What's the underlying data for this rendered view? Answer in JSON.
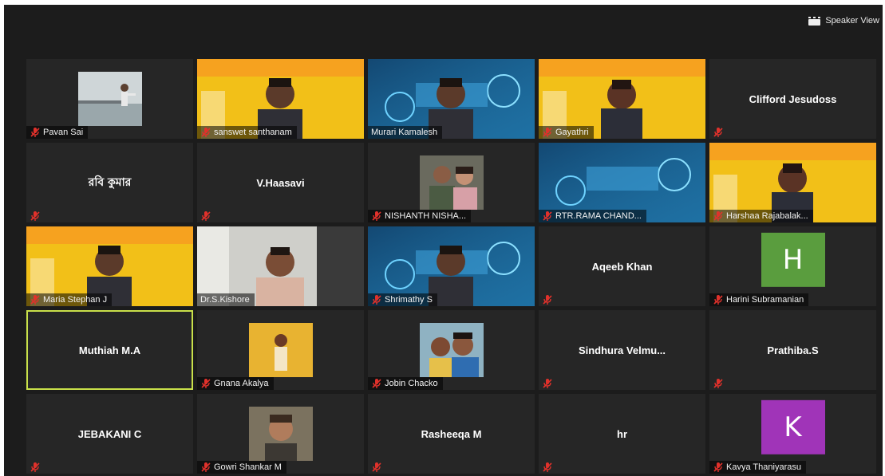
{
  "header": {
    "speaker_view_label": "Speaker View"
  },
  "icons": {
    "muted": "mic-muted-icon",
    "speaker_view": "speaker-view-icon"
  },
  "colors": {
    "background": "#1c1c1c",
    "tile": "#262626",
    "active_border": "#c9e04a",
    "muted_icon": "#e0312b"
  },
  "participants": [
    {
      "name": "Pavan Sai",
      "type": "photo",
      "muted": true,
      "photo": "pier"
    },
    {
      "name": "sanswet santhanam",
      "type": "video",
      "muted": true,
      "video": "yellowbanner"
    },
    {
      "name": "Murari Kamalesh",
      "type": "video",
      "muted": false,
      "video": "techbanner"
    },
    {
      "name": "Gayathri",
      "type": "video",
      "muted": true,
      "video": "yellowgirl"
    },
    {
      "name": "Clifford Jesudoss",
      "type": "text",
      "muted": true,
      "show_label": false
    },
    {
      "name": "রবি কুমার",
      "type": "text",
      "muted": true,
      "show_label": false,
      "script": "bn"
    },
    {
      "name": "V.Haasavi",
      "type": "text",
      "muted": true,
      "show_label": false
    },
    {
      "name": "NISHANTH NISHA...",
      "type": "photo",
      "muted": true,
      "photo": "couple"
    },
    {
      "name": "RTR.RAMA CHAND...",
      "type": "video",
      "muted": true,
      "video": "bluebanner"
    },
    {
      "name": "Harshaa Rajabalak...",
      "type": "video",
      "muted": true,
      "video": "yellowgirl2"
    },
    {
      "name": "Maria Stephan J",
      "type": "video",
      "muted": true,
      "video": "exquiz"
    },
    {
      "name": "Dr.S.Kishore",
      "type": "video",
      "muted": false,
      "video": "room"
    },
    {
      "name": "Shrimathy S",
      "type": "video",
      "muted": true,
      "video": "techbanner2"
    },
    {
      "name": "Aqeeb Khan",
      "type": "text",
      "muted": true,
      "show_label": false
    },
    {
      "name": "Harini Subramanian",
      "type": "letter",
      "letter": "H",
      "color": "#5a9d3e",
      "muted": true
    },
    {
      "name": "Muthiah M.A",
      "type": "text",
      "muted": false,
      "show_label": false,
      "active": true
    },
    {
      "name": "Gnana Akalya",
      "type": "photo",
      "muted": true,
      "photo": "orange"
    },
    {
      "name": "Jobin Chacko",
      "type": "photo",
      "muted": true,
      "photo": "selfie"
    },
    {
      "name": "Sindhura  Velmu...",
      "type": "text",
      "muted": true,
      "show_label": false
    },
    {
      "name": "Prathiba.S",
      "type": "text",
      "muted": true,
      "show_label": false
    },
    {
      "name": "JEBAKANI C",
      "type": "text",
      "muted": true,
      "show_label": false
    },
    {
      "name": "Gowri Shankar M",
      "type": "photo",
      "muted": true,
      "photo": "man"
    },
    {
      "name": "Rasheeqa M",
      "type": "text",
      "muted": true,
      "show_label": false
    },
    {
      "name": "hr",
      "type": "text",
      "muted": true,
      "show_label": false
    },
    {
      "name": "Kavya Thaniyarasu",
      "type": "letter",
      "letter": "K",
      "color": "#a034b8",
      "muted": true
    }
  ]
}
